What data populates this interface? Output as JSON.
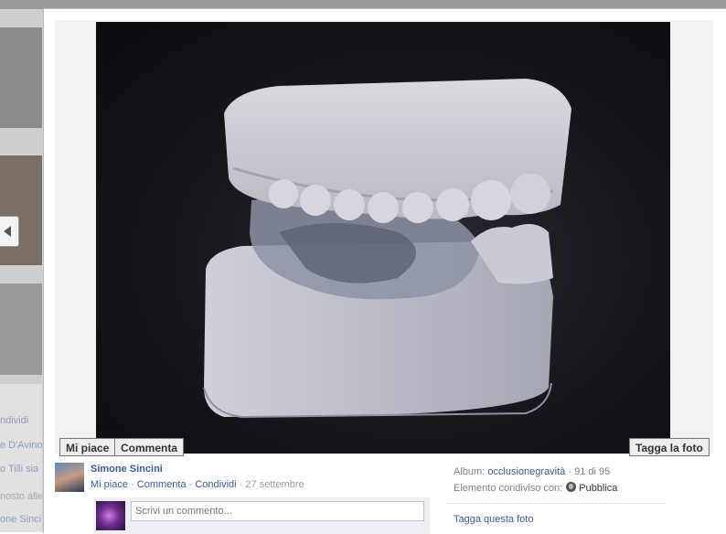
{
  "background": {
    "lines": [
      {
        "text": "ndividi",
        "style": "link"
      },
      {
        "text": "e D'Avino,",
        "style": "link"
      },
      {
        "text": "o Tilli sia",
        "style": "link"
      },
      {
        "text": "nosto alle",
        "style": "gray"
      },
      {
        "text": "one Sinci",
        "style": "link"
      }
    ]
  },
  "stage": {
    "like_button": "Mi piace",
    "comment_button": "Commenta",
    "tag_button": "Tagga la foto"
  },
  "post": {
    "author": "Simone Sincini",
    "actions": {
      "like": "Mi piace",
      "comment": "Commenta",
      "share": "Condividi",
      "date": "27 settembre",
      "separator": "·"
    },
    "comment_placeholder": "Scrivi un commento..."
  },
  "sidebar": {
    "album_label": "Album:",
    "album_name": "occlusionegravità",
    "position": "· 91 di 95",
    "shared_with_label": "Elemento condiviso con:",
    "audience": "Pubblica",
    "tag_photo": "Tagga questa foto"
  },
  "colors": {
    "link": "#3b5998",
    "comment_box_bg": "#edeff4"
  }
}
